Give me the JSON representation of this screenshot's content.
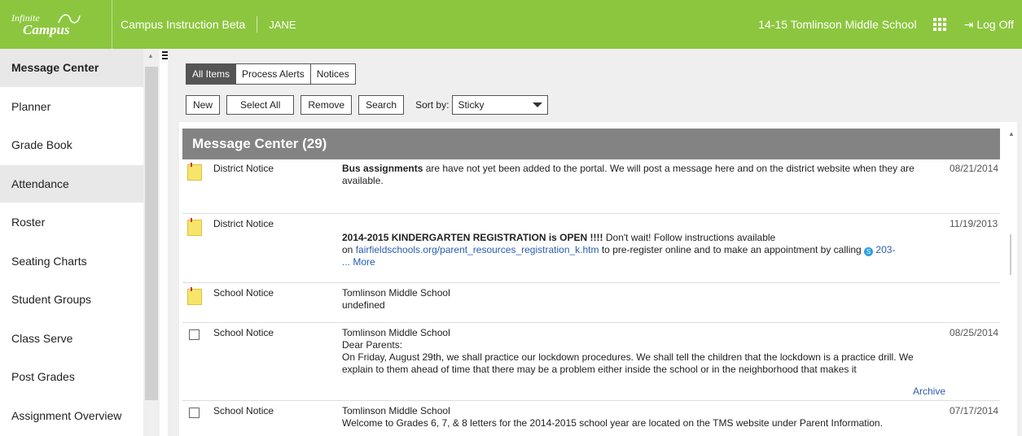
{
  "header": {
    "logo_line1": "Infinite",
    "logo_line2": "Campus",
    "app_title": "Campus Instruction Beta",
    "user": "JANE",
    "school": "14-15 Tomlinson Middle School",
    "logoff": "Log Off"
  },
  "sidebar": {
    "items": [
      {
        "label": "Message Center"
      },
      {
        "label": "Planner"
      },
      {
        "label": "Grade Book"
      },
      {
        "label": "Attendance"
      },
      {
        "label": "Roster"
      },
      {
        "label": "Seating Charts"
      },
      {
        "label": "Student Groups"
      },
      {
        "label": "Class Serve"
      },
      {
        "label": "Post Grades"
      },
      {
        "label": "Assignment Overview"
      }
    ]
  },
  "tabs": [
    "All Items",
    "Process Alerts",
    "Notices"
  ],
  "toolbar": {
    "new": "New",
    "select_all": "Select All",
    "remove": "Remove",
    "search": "Search",
    "sort_label": "Sort by:",
    "sort_value": "Sticky"
  },
  "panel": {
    "title": "Message Center (29)"
  },
  "messages": [
    {
      "type": "District Notice",
      "bold": "Bus assignments",
      "text": " are have not yet been added to the portal. We will post a message here and on the district website when they are available.",
      "date": "08/21/2014"
    },
    {
      "type": "District Notice",
      "bold": "2014-2015 KINDERGARTEN REGISTRATION is OPEN !!!!",
      "text1": " Don't wait! Follow instructions available",
      "text2_pre": "on ",
      "link": "fairfieldschools.org/parent_resources_registration_k.htm",
      "text2_post": " to pre-register online and to make an appointment by calling ",
      "phone": "203-",
      "more": "... More",
      "date": "11/19/2013"
    },
    {
      "type": "School Notice",
      "line1": "Tomlinson Middle School",
      "line2": "undefined"
    },
    {
      "type": "School Notice",
      "line1": "Tomlinson Middle School",
      "line2": "Dear Parents:",
      "line3": "On Friday, August 29th, we shall practice our lockdown procedures.  We shall tell the children that the lockdown is a practice drill.  We explain to them ahead of time that there may be a problem either inside the school or in the neighborhood that makes it",
      "archive": "Archive",
      "date": "08/25/2014"
    },
    {
      "type": "School Notice",
      "line1": "Tomlinson Middle School",
      "line2": "Welcome to Grades 6, 7, & 8 letters for the 2014-2015 school year are located on the TMS website under Parent Information.",
      "date": "07/17/2014"
    }
  ]
}
